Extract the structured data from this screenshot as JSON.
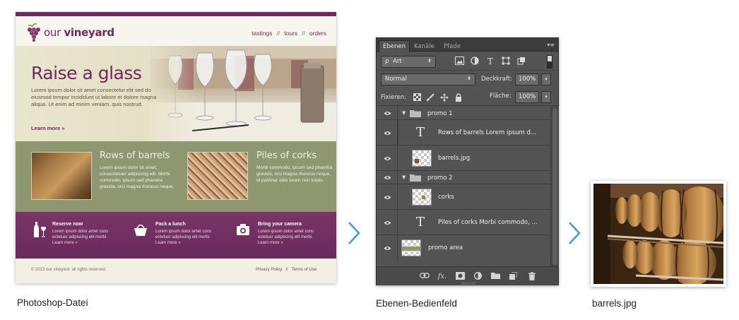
{
  "site": {
    "logo": "our vineyard",
    "logo_prefix": "our ",
    "logo_bold": "vineyard",
    "nav": [
      "tastings",
      "tours",
      "orders"
    ],
    "nav_sep": "//",
    "hero": {
      "title": "Raise a glass",
      "text": "Lorem ipsum dolor sit amet consectetur elit sed do eiusmod tempor incididunt ut labore et dolore magna aliqua. Ut enim ad minim veniam, quis nostrud.",
      "more": "Learn more »"
    },
    "promos": [
      {
        "title": "Rows of barrels",
        "text": "Lorem ipsum dolor sit amet, consectetuer adipiscing elit. Morbi commodo, ipsum sed pharetra gravida, orci magna rhoncus neque."
      },
      {
        "title": "Piles of corks",
        "text": "Morbi commodo, ipsum sed pharetra gravida, orci magna rhoncus neque, id pulvinar odio lorem non turpis."
      }
    ],
    "band": [
      {
        "title": "Reserve now",
        "text": "Lorem ipsum dolor amet cons ectetuer adipiscing elit morbi.",
        "more": "Learn more »",
        "icon": "wine-bottle-icon"
      },
      {
        "title": "Pack a lunch",
        "text": "Lorem ipsum dolor amet cons ectetuer adipiscing elit morbi.",
        "more": "Learn more »",
        "icon": "basket-icon"
      },
      {
        "title": "Bring your camera",
        "text": "Lorem ipsum dolor amet cons ectetuer adipiscing elit morbi.",
        "more": "Learn more »",
        "icon": "camera-icon"
      }
    ],
    "footer": {
      "copyright": "© 2013 our vineyard. all rights reserved.",
      "links": [
        "Privacy Policy",
        "Terms of Use"
      ],
      "sep": "//"
    }
  },
  "captions": {
    "psd": "Photoshop-Datei",
    "layers": "Ebenen-Bedienfeld",
    "image": "barrels.jpg"
  },
  "panel": {
    "tabs": [
      "Ebenen",
      "Kanäle",
      "Pfade"
    ],
    "menu_glyph": "▾≡",
    "filter": {
      "value": "Art",
      "glyph": "ρ"
    },
    "blend": {
      "value": "Normal"
    },
    "opacity": {
      "label": "Deckkraft:",
      "value": "100%"
    },
    "lock": {
      "label": "Fixieren:"
    },
    "fill": {
      "label": "Fläche:",
      "value": "100%"
    },
    "layers": [
      {
        "name": "promo 1",
        "kind": "group"
      },
      {
        "name": "Rows of barrels Lorem ipsum d...",
        "kind": "text"
      },
      {
        "name": "barrels.jpg",
        "kind": "image"
      },
      {
        "name": "promo 2",
        "kind": "group"
      },
      {
        "name": "corks",
        "kind": "image"
      },
      {
        "name": "Piles of corks Morbi commodo, ...",
        "kind": "text"
      },
      {
        "name": "promo area",
        "kind": "image"
      }
    ],
    "text_glyph": "T",
    "fx_label": "fx."
  },
  "colors": {
    "brand_purple": "#6e2a5e",
    "promo_green": "#8e9770",
    "panel_bg": "#535353",
    "arrow_blue": "#3aa0d4"
  }
}
